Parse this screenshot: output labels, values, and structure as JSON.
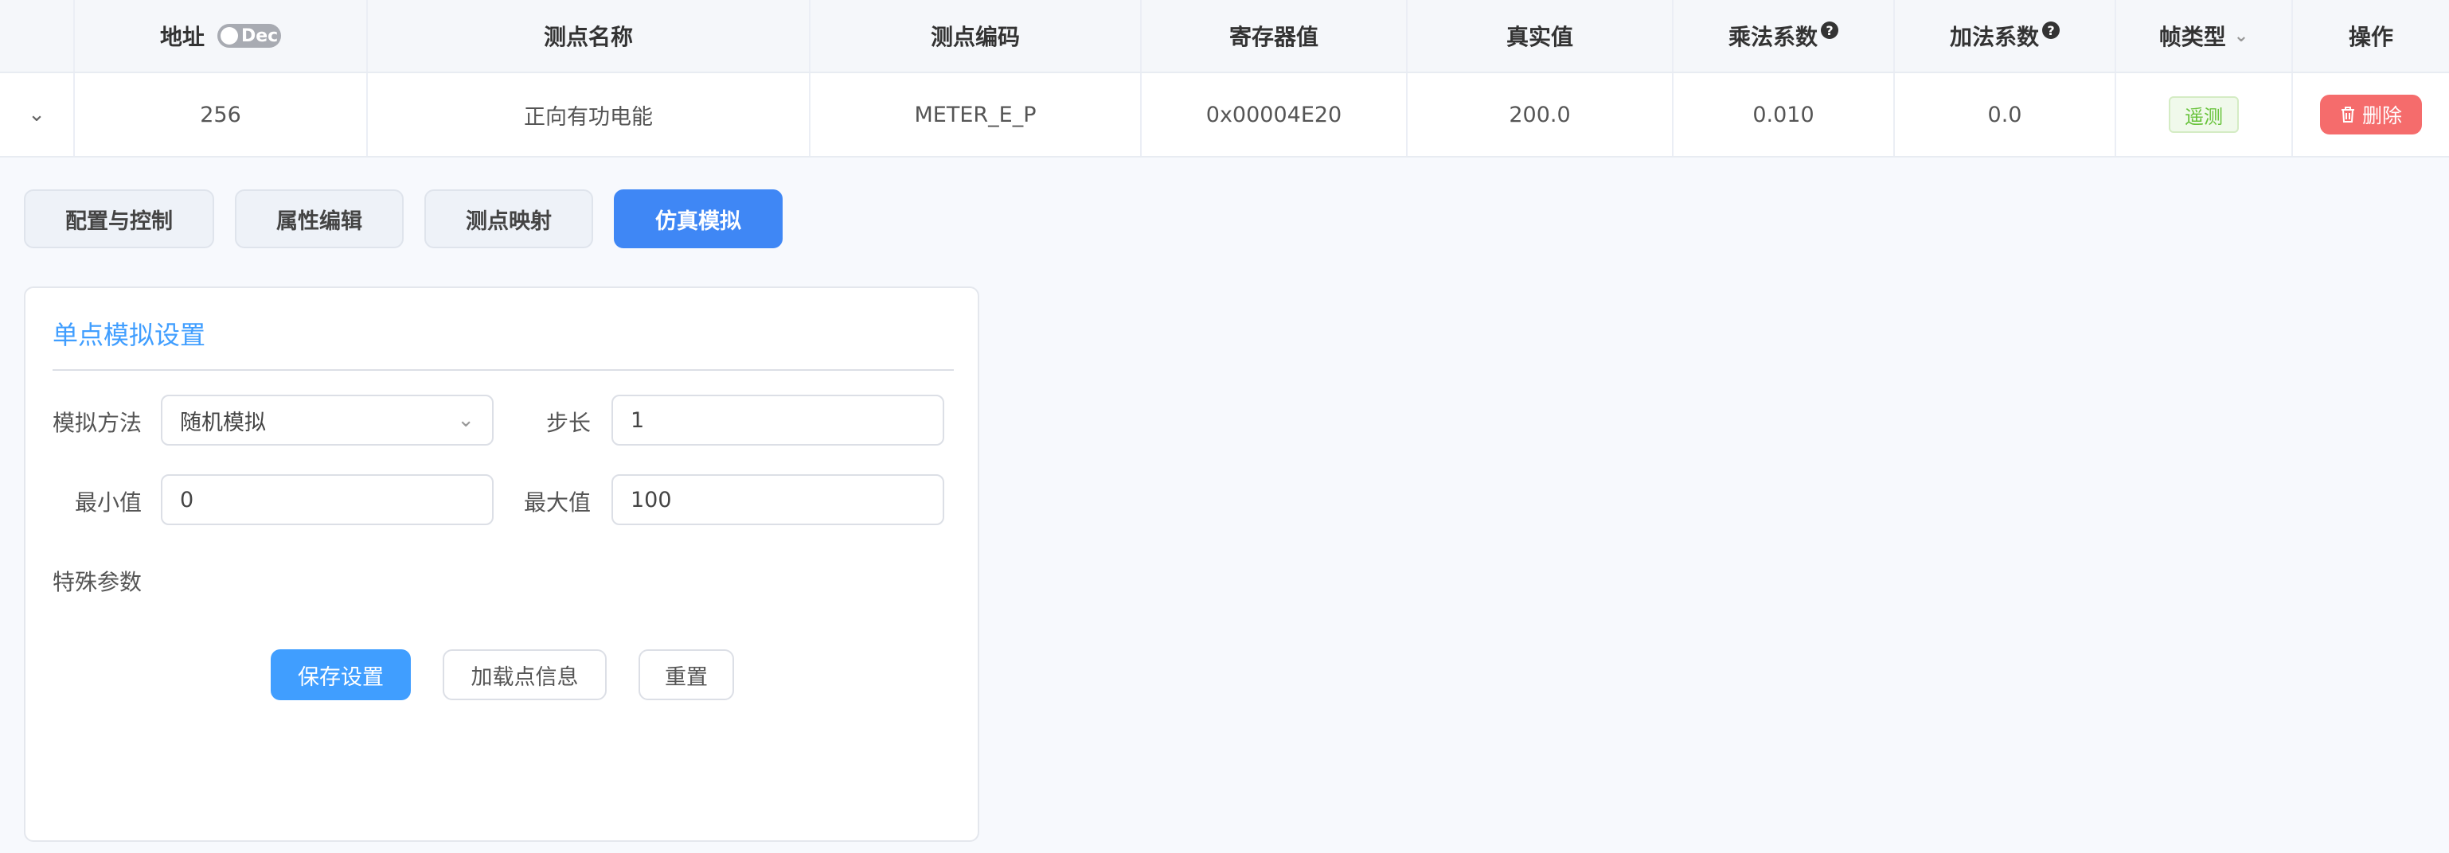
{
  "table": {
    "headers": {
      "address": "地址",
      "toggle_label": "Dec",
      "name": "测点名称",
      "code": "测点编码",
      "register_value": "寄存器值",
      "real_value": "真实值",
      "multiplier": "乘法系数",
      "adder": "加法系数",
      "frame_type": "帧类型",
      "operation": "操作"
    },
    "rows": [
      {
        "address": "256",
        "name": "正向有功电能",
        "code": "METER_E_P",
        "register_value": "0x00004E20",
        "real_value": "200.0",
        "multiplier": "0.010",
        "adder": "0.0",
        "frame_type": "遥测",
        "delete_label": "删除"
      }
    ]
  },
  "tabs": [
    {
      "label": "配置与控制",
      "active": false
    },
    {
      "label": "属性编辑",
      "active": false
    },
    {
      "label": "测点映射",
      "active": false
    },
    {
      "label": "仿真模拟",
      "active": true
    }
  ],
  "simulation": {
    "title": "单点模拟设置",
    "method_label": "模拟方法",
    "method_value": "随机模拟",
    "step_label": "步长",
    "step_value": "1",
    "min_label": "最小值",
    "min_value": "0",
    "max_label": "最大值",
    "max_value": "100",
    "special_label": "特殊参数",
    "save_label": "保存设置",
    "load_label": "加载点信息",
    "reset_label": "重置"
  },
  "colors": {
    "primary": "#409eff",
    "active_tab": "#3f87f5",
    "danger": "#f56c6c",
    "success": "#67c23a"
  },
  "icons": {
    "help": "question-circle-icon",
    "expand": "chevron-down-icon",
    "delete": "trash-icon"
  }
}
